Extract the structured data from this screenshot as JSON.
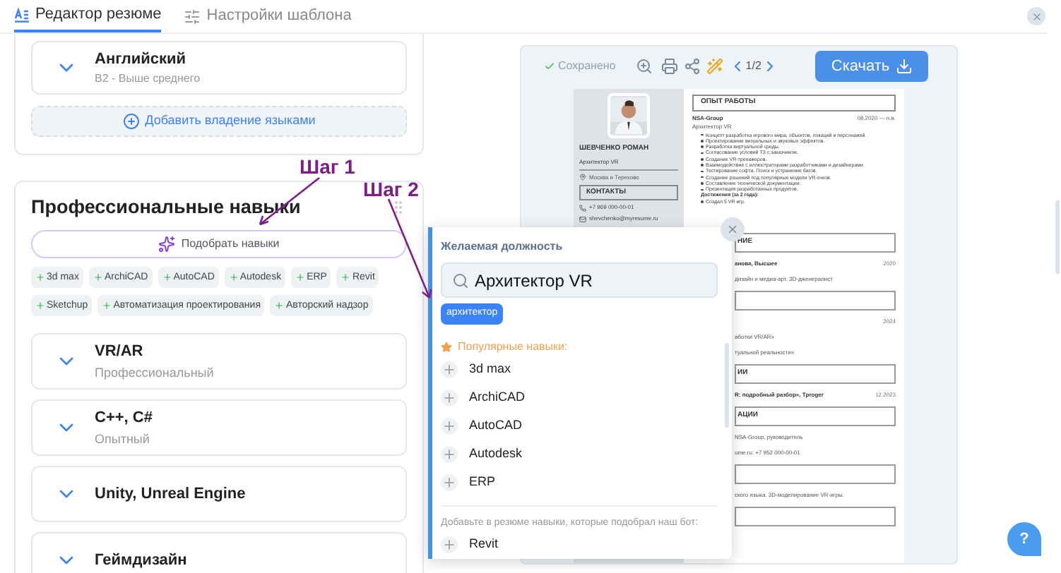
{
  "tabs": [
    {
      "label": "Редактор резюме",
      "selected": true
    },
    {
      "label": "Настройки шаблона",
      "selected": false
    }
  ],
  "languages": {
    "items": [
      {
        "name": "Английский",
        "level": "B2 - Выше среднего"
      }
    ],
    "add_button": "Добавить владение языками"
  },
  "skills": {
    "title": "Профессиональные навыки",
    "suggest_button": "Подобрать навыки",
    "chips": [
      "3d max",
      "ArchiCAD",
      "AutoCAD",
      "Autodesk",
      "ERP",
      "Revit",
      "Sketchup",
      "Автоматизация проектирования",
      "Авторский надзор"
    ],
    "items": [
      {
        "name": "VR/AR",
        "level": "Профессиональный"
      },
      {
        "name": "C++, C#",
        "level": "Опытный"
      },
      {
        "name": "Unity, Unreal Engine"
      },
      {
        "name": "Геймдизайн"
      }
    ]
  },
  "annotations": [
    {
      "text": "Шаг 1"
    },
    {
      "text": "Шаг 2"
    }
  ],
  "preview": {
    "status": "Сохранено",
    "page_indicator": "1/2",
    "download_button": "Скачать",
    "resume": {
      "name": "ШЕВЧЕНКО РОМАН",
      "position": "Архитектор VR",
      "location": "Москва и Терехово",
      "contacts_title": "КОНТАКТЫ",
      "phone": "+7 969 000-00-01",
      "email": "shevchenko@myresume.ru",
      "section_title": "ОПЫТ РАБОТЫ",
      "company": "NSA-Group",
      "dates": "08.2020 — н.в.",
      "role": "Архитектор VR",
      "bullets": [
        "Концепт разработка игрового мира, объектов, локаций и персонажей.",
        "Проектирование визуальных и звуковых эффектов.",
        "Разработка виртуальной среды.",
        "Согласование условий ТЗ с заказчиком.",
        "Создание VR-тренажеров.",
        "Взаимодействие с иллюстраторами разработчиками и дизайнерами.",
        "Тестирование софта. Поиск и устранение багов.",
        "Создание решений под популярные модели VR-очков.",
        "Составление технической документации.",
        "Презентация разработанных продуктов."
      ],
      "achievements_title": "Достижения (за 2 года):",
      "achievements": [
        "Создал 5 VR игр."
      ],
      "lower": [
        {
          "kind": "header",
          "text": "НИЕ"
        },
        {
          "kind": "row",
          "text": "анова, Высшее",
          "date": "2020"
        },
        {
          "kind": "line",
          "text": "дизайн и медиа-арт. 3D-дженералист"
        },
        {
          "kind": "header"
        },
        {
          "kind": "row",
          "date": "2024"
        },
        {
          "kind": "line",
          "text": "аботки VR/AR»"
        },
        {
          "kind": "line",
          "text": "туальной реальности»"
        },
        {
          "kind": "header",
          "text": "ИИ"
        },
        {
          "kind": "row",
          "text": "R: подробный разбор», Tproger",
          "date": "12.2023"
        },
        {
          "kind": "header",
          "text": "АЦИИ"
        },
        {
          "kind": "line",
          "text": "NSA-Group, руководитель"
        },
        {
          "kind": "line",
          "text": "ume.ru: +7 952 000-00-01"
        },
        {
          "kind": "header"
        },
        {
          "kind": "line",
          "text": "ского языка. 3D-моделирование VR-игры."
        },
        {
          "kind": "header"
        }
      ]
    }
  },
  "popup": {
    "label": "Желаемая должность",
    "search_value": "Архитектор VR",
    "tag": "архитектор",
    "popular_title": "Популярные навыки:",
    "popular": [
      "3d max",
      "ArchiCAD",
      "AutoCAD",
      "Autodesk",
      "ERP"
    ],
    "bot_title": "Добавьте в резюме навыки, которые подобрал наш бот:",
    "bot": [
      "Revit"
    ]
  },
  "help_button": "?"
}
